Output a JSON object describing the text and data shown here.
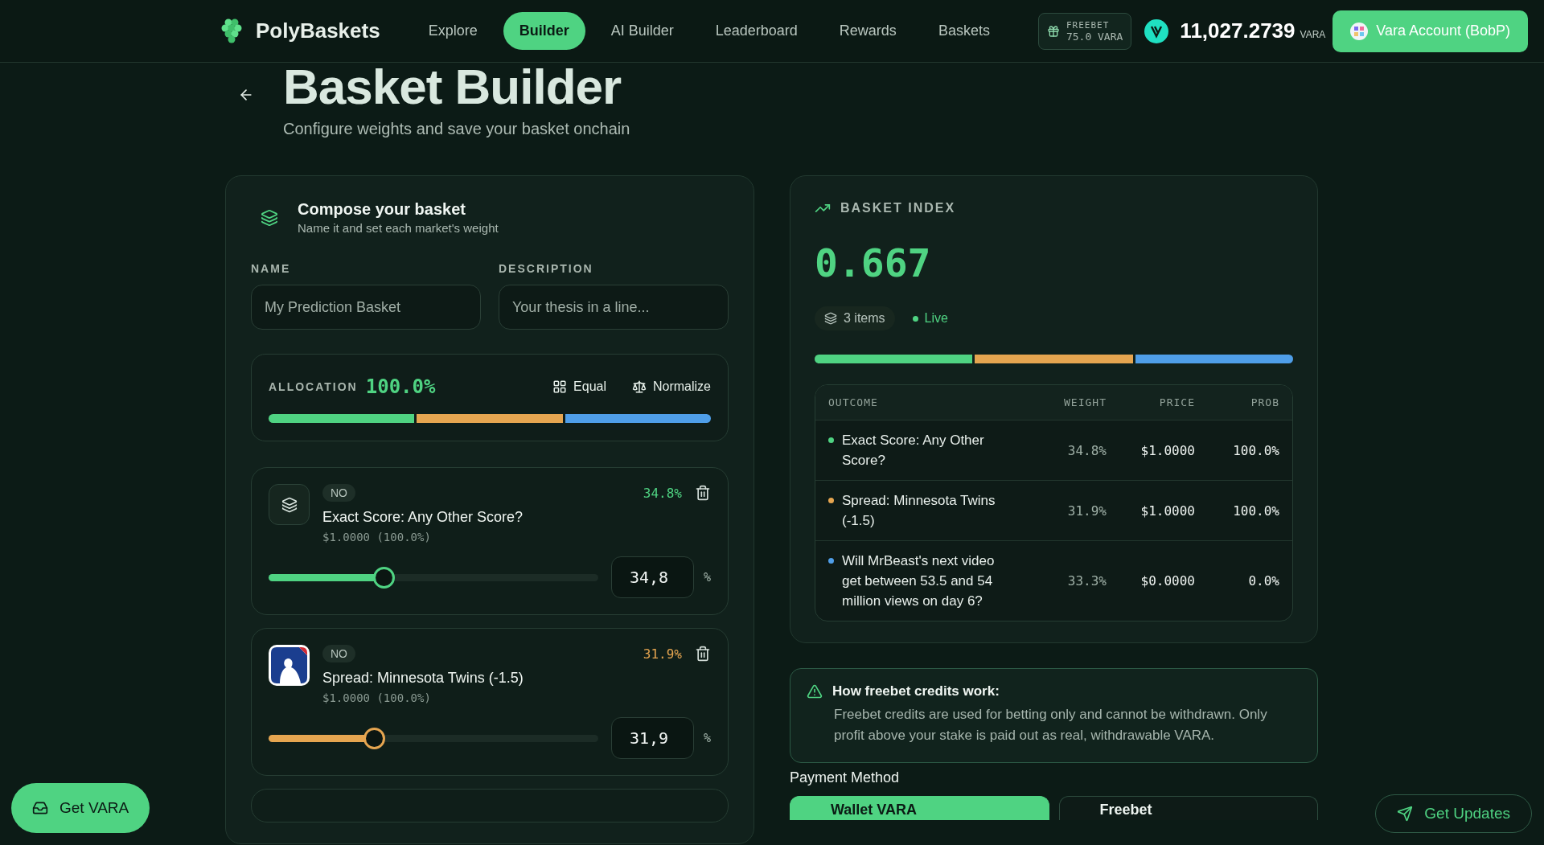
{
  "header": {
    "brand": "PolyBaskets",
    "nav": [
      {
        "label": "Explore",
        "selected": false
      },
      {
        "label": "Builder",
        "selected": true
      },
      {
        "label": "AI Builder",
        "selected": false
      },
      {
        "label": "Leaderboard",
        "selected": false
      },
      {
        "label": "Rewards",
        "selected": false
      },
      {
        "label": "Baskets",
        "selected": false
      }
    ],
    "freebet": {
      "label": "FREEBET",
      "amount": "75.0 VARA"
    },
    "balance": {
      "amount": "11,027.2739",
      "unit": "VARA"
    },
    "account_button": "Vara Account (BobP)"
  },
  "page": {
    "title": "Basket Builder",
    "subtitle": "Configure weights and save your basket onchain"
  },
  "compose": {
    "title": "Compose your basket",
    "subtitle": "Name it and set each market's weight",
    "fields": [
      {
        "label": "NAME",
        "placeholder": "My Prediction Basket"
      },
      {
        "label": "DESCRIPTION",
        "placeholder": "Your thesis in a line..."
      }
    ],
    "allocation": {
      "label": "ALLOCATION",
      "total": "100.0%",
      "actions": [
        "Equal",
        "Normalize"
      ]
    },
    "segments": [
      {
        "color": "#4fd382"
      },
      {
        "color": "#e5a550"
      },
      {
        "color": "#4f9ee8"
      }
    ],
    "markets": [
      {
        "kind": "layers",
        "side": "NO",
        "title": "Exact Score: Any Other Score?",
        "price": "$1.0000 (100.0%)",
        "weight": "34.8%",
        "color": "#4fd382",
        "level": 0.348,
        "value": "34,8",
        "unit": "%"
      },
      {
        "kind": "logo",
        "side": "NO",
        "title": "Spread: Minnesota Twins (-1.5)",
        "price": "$1.0000 (100.0%)",
        "weight": "31.9%",
        "color": "#e5a550",
        "level": 0.319,
        "value": "31,9",
        "unit": "%"
      }
    ]
  },
  "index": {
    "label": "BASKET INDEX",
    "value": "0.667",
    "items": "3 items",
    "status": "Live",
    "segments": [
      {
        "color": "#4fd382"
      },
      {
        "color": "#e5a550"
      },
      {
        "color": "#4f9ee8"
      }
    ],
    "table": {
      "columns": [
        "OUTCOME",
        "WEIGHT",
        "PRICE",
        "PROB"
      ],
      "rows": [
        {
          "outcome": "Exact Score: Any Other Score?",
          "weight": "34.8%",
          "price": "$1.0000",
          "prob": "100.0%",
          "color": "#4fd382"
        },
        {
          "outcome": "Spread: Minnesota Twins (-1.5)",
          "weight": "31.9%",
          "price": "$1.0000",
          "prob": "100.0%",
          "color": "#e5a550"
        },
        {
          "outcome": "Will MrBeast's next video get between 53.5 and 54 million views on day 6?",
          "weight": "33.3%",
          "price": "$0.0000",
          "prob": "0.0%",
          "color": "#4f9ee8"
        }
      ]
    }
  },
  "info": {
    "title": "How freebet credits work:",
    "text": "Freebet credits are used for betting only and cannot be withdrawn. Only profit above your stake is paid out as real, withdrawable VARA."
  },
  "payment": {
    "label": "Payment Method",
    "options": [
      {
        "label": "Wallet VARA",
        "selected": true
      },
      {
        "label": "Freebet",
        "selected": false
      }
    ]
  },
  "floating": {
    "get_vara": "Get VARA",
    "get_updates": "Get Updates"
  }
}
